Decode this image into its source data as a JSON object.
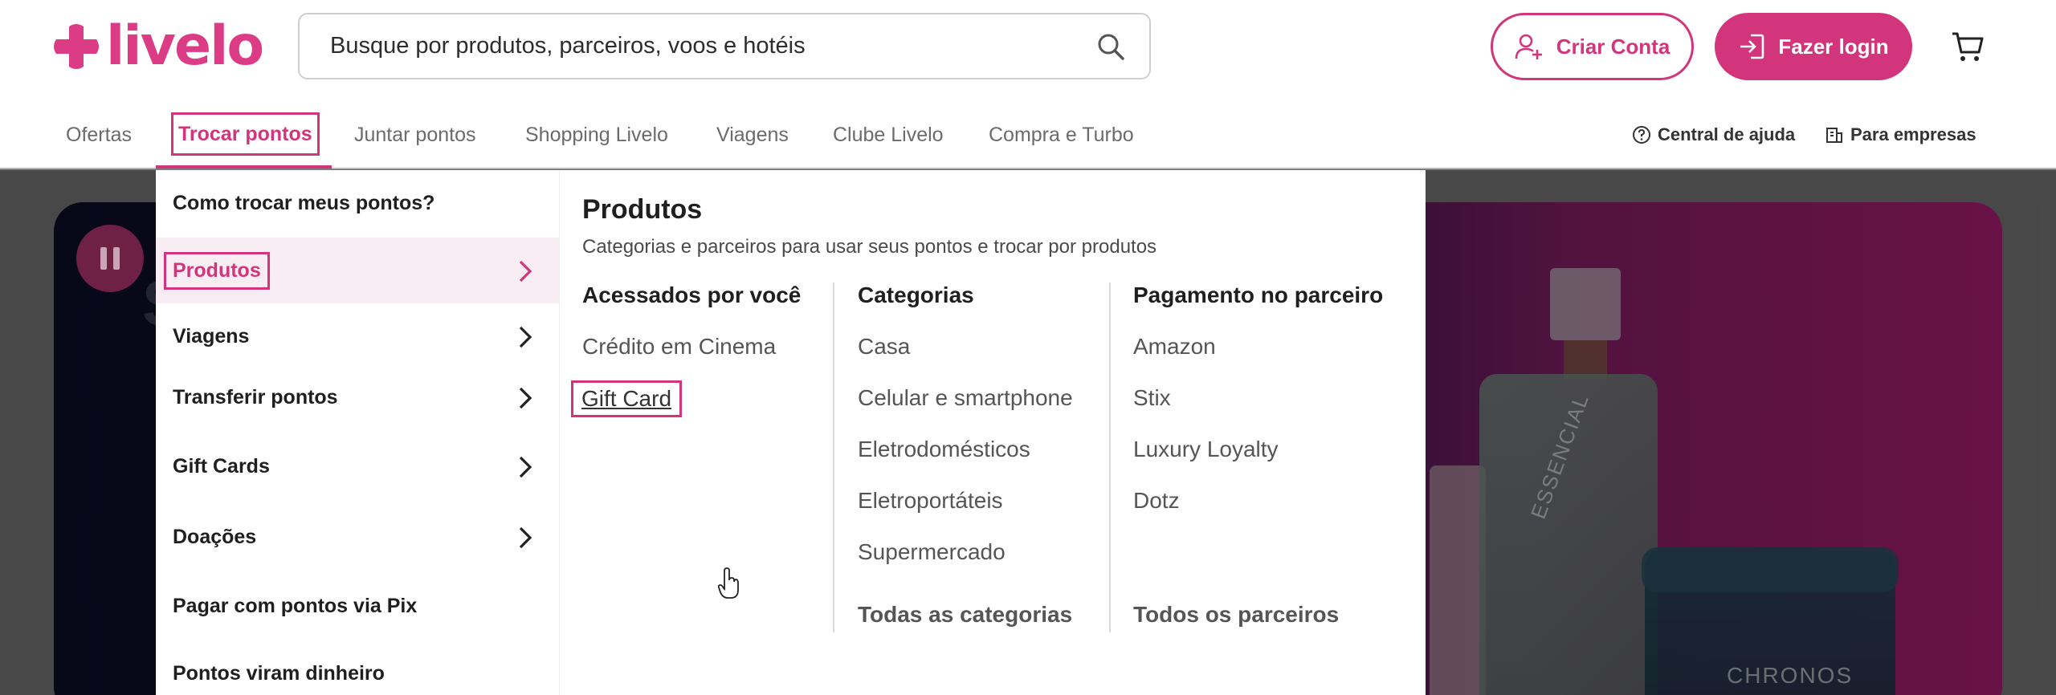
{
  "header": {
    "logo_text": "livelo",
    "search_placeholder": "Busque por produtos, parceiros, voos e hotéis",
    "criar_conta": "Criar Conta",
    "fazer_login": "Fazer login"
  },
  "nav": {
    "items": [
      "Ofertas",
      "Trocar pontos",
      "Juntar pontos",
      "Shopping Livelo",
      "Viagens",
      "Clube Livelo",
      "Compra e Turbo"
    ],
    "central_ajuda": "Central de ajuda",
    "para_empresas": "Para empresas"
  },
  "menu": {
    "left": {
      "intro": "Como trocar meus pontos?",
      "items": [
        "Produtos",
        "Viagens",
        "Transferir pontos",
        "Gift Cards",
        "Doações",
        "Pagar com pontos via Pix",
        "Pontos viram dinheiro"
      ]
    },
    "right": {
      "title": "Produtos",
      "subtitle": "Categorias e parceiros para usar seus pontos e trocar por produtos",
      "col1": {
        "heading": "Acessados por você",
        "links": [
          "Crédito em Cinema",
          "Gift Card"
        ]
      },
      "col2": {
        "heading": "Categorias",
        "links": [
          "Casa",
          "Celular e smartphone",
          "Eletrodomésticos",
          "Eletroportáteis",
          "Supermercado"
        ],
        "footer": "Todas as categorias"
      },
      "col3": {
        "heading": "Pagamento no parceiro",
        "links": [
          "Amazon",
          "Stix",
          "Luxury Loyalty",
          "Dotz"
        ],
        "footer": "Todos os parceiros"
      }
    }
  },
  "hero": {
    "product_label_1": "ESSENCIAL",
    "product_label_2": "CHRONOS"
  },
  "colors": {
    "brand": "#d2357c",
    "logo": "#dc3c85"
  }
}
